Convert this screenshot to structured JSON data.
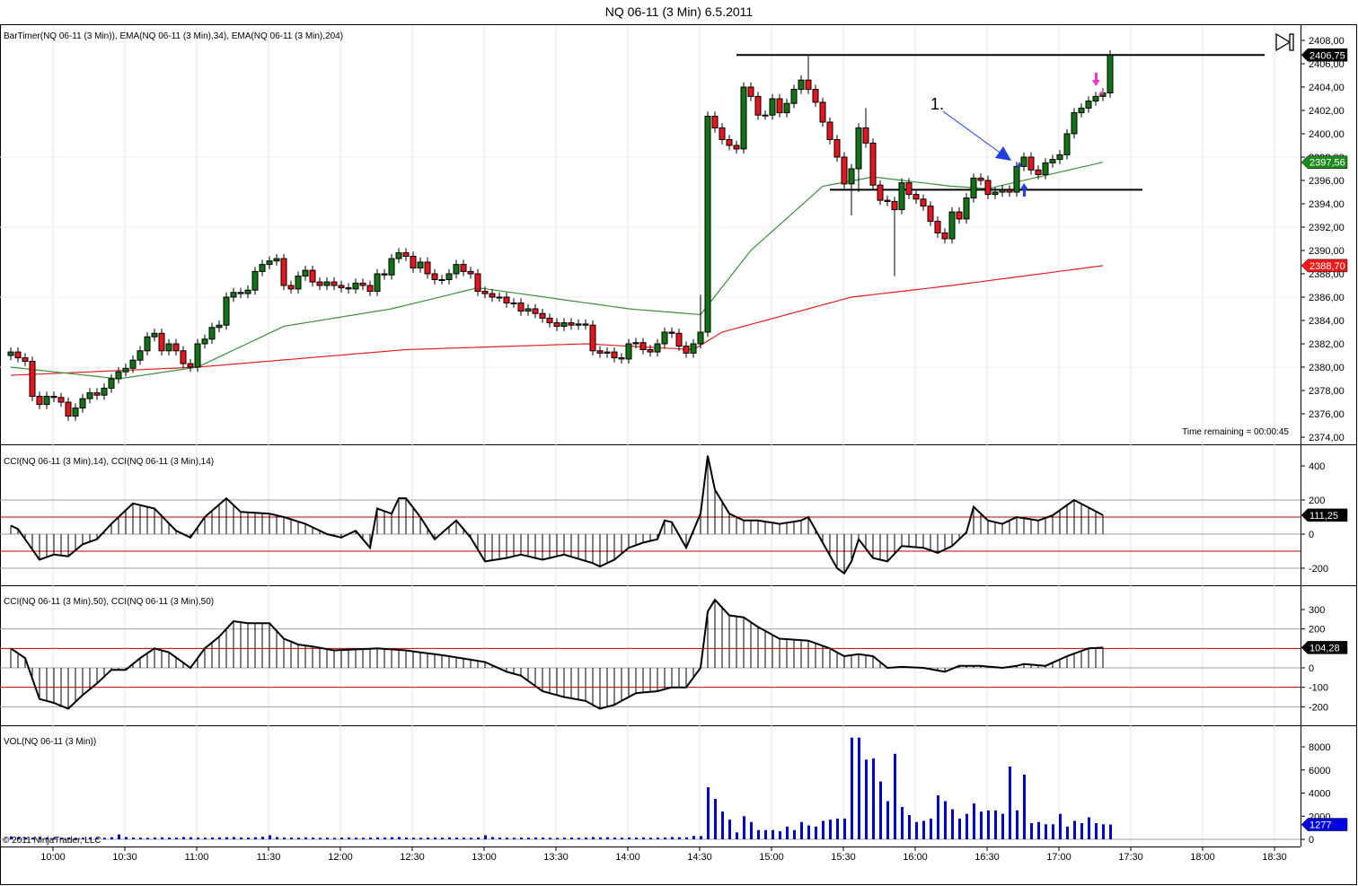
{
  "window": {
    "title": "NQ 06-11 (3 Min)  6.5.2011"
  },
  "colors": {
    "up": "#137313",
    "down": "#e8141c",
    "ema34": "#3d8f3d",
    "ema204": "#e02020",
    "volume": "#0000c8",
    "level_line": "#c00000",
    "annotation_blue": "#1f3fe0",
    "annotation_pink": "#ff33cc"
  },
  "panels": {
    "price": {
      "label": "BarTimer(NQ 06-11 (3 Min)), EMA(NQ 06-11 (3 Min),34), EMA(NQ 06-11 (3 Min),204)",
      "time_remaining": "Time remaining = 00:00:45"
    },
    "cci14": {
      "label": "CCI(NQ 06-11 (3 Min),14), CCI(NQ 06-11 (3 Min),14)"
    },
    "cci50": {
      "label": "CCI(NQ 06-11 (3 Min),50), CCI(NQ 06-11 (3 Min),50)"
    },
    "volume": {
      "label": "VOL(NQ 06-11 (3 Min))"
    },
    "copyright": "© 2011 NinjaTrader, LLC"
  },
  "chart_data": {
    "type": "candlestick",
    "title": "NQ 06-11 (3 Min)  6.5.2011",
    "bar_interval_minutes": 3,
    "first_bar_time": "9:42",
    "x_ticks": [
      "10:00",
      "10:30",
      "11:00",
      "11:30",
      "12:00",
      "12:30",
      "13:00",
      "13:30",
      "14:00",
      "14:30",
      "15:00",
      "15:30",
      "16:00",
      "16:30",
      "17:00",
      "17:30",
      "18:00",
      "18:30"
    ],
    "price_ticks": [
      "2408,00",
      "2406,00",
      "2404,00",
      "2402,00",
      "2400,00",
      "2398,00",
      "2396,00",
      "2394,00",
      "2392,00",
      "2390,00",
      "2388,00",
      "2386,00",
      "2384,00",
      "2382,00",
      "2380,00",
      "2378,00",
      "2376,00",
      "2374,00"
    ],
    "price_range": [
      2373.2,
      2409.3
    ],
    "closes": [
      2381.3,
      2380.8,
      2380.5,
      2377.5,
      2376.8,
      2377.5,
      2377.4,
      2377.0,
      2375.8,
      2376.5,
      2377.3,
      2377.8,
      2377.6,
      2378.2,
      2379.0,
      2379.6,
      2379.9,
      2380.6,
      2381.4,
      2382.6,
      2382.9,
      2381.4,
      2382.0,
      2381.4,
      2380.3,
      2380.0,
      2382.0,
      2382.4,
      2383.4,
      2383.6,
      2386.0,
      2386.4,
      2386.3,
      2386.6,
      2388.2,
      2388.8,
      2389.1,
      2389.3,
      2387.0,
      2386.7,
      2387.8,
      2388.3,
      2387.3,
      2387.0,
      2387.3,
      2387.0,
      2386.8,
      2386.7,
      2387.2,
      2387.0,
      2386.5,
      2388.0,
      2387.9,
      2389.3,
      2389.8,
      2389.5,
      2388.5,
      2389.0,
      2388.0,
      2387.5,
      2387.5,
      2388.0,
      2388.8,
      2388.2,
      2388.0,
      2386.5,
      2386.3,
      2386.0,
      2386.0,
      2385.5,
      2385.5,
      2384.8,
      2385.0,
      2384.6,
      2384.2,
      2383.8,
      2383.5,
      2383.8,
      2383.6,
      2383.7,
      2383.6,
      2381.4,
      2381.2,
      2381.3,
      2380.8,
      2380.7,
      2382.0,
      2382.1,
      2381.5,
      2381.3,
      2382.0,
      2383.0,
      2382.9,
      2381.8,
      2381.2,
      2382.0,
      2383.0,
      2401.5,
      2400.5,
      2399.5,
      2399.0,
      2398.7,
      2404.0,
      2403.2,
      2401.6,
      2401.6,
      2403.0,
      2401.8,
      2402.6,
      2403.8,
      2404.6,
      2403.8,
      2402.7,
      2401.0,
      2399.5,
      2398.0,
      2395.7,
      2397.0,
      2400.5,
      2399.2,
      2395.6,
      2394.3,
      2394.2,
      2393.5,
      2395.8,
      2394.8,
      2394.4,
      2393.8,
      2392.5,
      2391.5,
      2391.0,
      2393.3,
      2392.7,
      2394.5,
      2396.2,
      2396.0,
      2394.8,
      2395.0,
      2395.2,
      2395.0,
      2397.2,
      2398.0,
      2396.9,
      2396.5,
      2397.5,
      2397.8,
      2398.2,
      2400.0,
      2401.8,
      2402.2,
      2402.8,
      2403.2,
      2403.5,
      2406.75
    ],
    "first_open": 2381.0,
    "high_overrides": {
      "111": 2406.75,
      "119": 2402.2,
      "96": 2386.2
    },
    "low_overrides": {
      "117": 2393.0,
      "123": 2387.8,
      "118": 2395.0
    },
    "ema34_points": [
      [
        0,
        2380.0
      ],
      [
        15,
        2379.0
      ],
      [
        26,
        2380.0
      ],
      [
        38,
        2383.5
      ],
      [
        53,
        2385.0
      ],
      [
        65,
        2386.8
      ],
      [
        86,
        2385.0
      ],
      [
        96,
        2384.5
      ],
      [
        103,
        2390.0
      ],
      [
        113,
        2395.5
      ],
      [
        120,
        2396.3
      ],
      [
        131,
        2395.5
      ],
      [
        136,
        2395.3
      ],
      [
        152,
        2397.56
      ]
    ],
    "ema204_points": [
      [
        0,
        2379.3
      ],
      [
        26,
        2380.0
      ],
      [
        55,
        2381.5
      ],
      [
        80,
        2382.0
      ],
      [
        95,
        2381.5
      ],
      [
        99,
        2383.0
      ],
      [
        117,
        2386.0
      ],
      [
        131,
        2387.0
      ],
      [
        152,
        2388.7
      ]
    ],
    "last_values": {
      "price": "2406,75",
      "ema34": "2397,56",
      "ema204": "2388,70",
      "cci14": "111,25",
      "cci50": "104,28",
      "volume": "1277"
    },
    "drawn_levels": [
      {
        "price": 2406.75,
        "from_bar": 101,
        "to_bar": 175
      },
      {
        "price": 2395.2,
        "from_bar": 114,
        "to_bar": 158
      }
    ],
    "annotations": {
      "label": "1."
    },
    "cci14": {
      "ticks": [
        "400",
        "200",
        "0",
        "-200"
      ],
      "points": [
        [
          0,
          50
        ],
        [
          1,
          30
        ],
        [
          3,
          -90
        ],
        [
          4,
          -150
        ],
        [
          6,
          -120
        ],
        [
          8,
          -130
        ],
        [
          10,
          -60
        ],
        [
          12,
          -30
        ],
        [
          14,
          60
        ],
        [
          17,
          180
        ],
        [
          20,
          150
        ],
        [
          23,
          20
        ],
        [
          25,
          -20
        ],
        [
          27,
          100
        ],
        [
          30,
          210
        ],
        [
          32,
          130
        ],
        [
          36,
          120
        ],
        [
          38,
          100
        ],
        [
          41,
          60
        ],
        [
          44,
          0
        ],
        [
          46,
          -20
        ],
        [
          48,
          20
        ],
        [
          50,
          -80
        ],
        [
          51,
          150
        ],
        [
          53,
          120
        ],
        [
          54,
          210
        ],
        [
          55,
          210
        ],
        [
          57,
          100
        ],
        [
          59,
          -30
        ],
        [
          62,
          80
        ],
        [
          64,
          -20
        ],
        [
          66,
          -160
        ],
        [
          69,
          -140
        ],
        [
          71,
          -120
        ],
        [
          74,
          -150
        ],
        [
          77,
          -120
        ],
        [
          81,
          -170
        ],
        [
          82,
          -190
        ],
        [
          84,
          -150
        ],
        [
          86,
          -80
        ],
        [
          88,
          -50
        ],
        [
          90,
          -30
        ],
        [
          91,
          80
        ],
        [
          92,
          70
        ],
        [
          94,
          -80
        ],
        [
          96,
          120
        ],
        [
          97,
          460
        ],
        [
          98,
          260
        ],
        [
          100,
          120
        ],
        [
          102,
          80
        ],
        [
          104,
          80
        ],
        [
          107,
          60
        ],
        [
          110,
          80
        ],
        [
          111,
          100
        ],
        [
          113,
          -50
        ],
        [
          115,
          -200
        ],
        [
          116,
          -230
        ],
        [
          117,
          -160
        ],
        [
          118,
          -30
        ],
        [
          120,
          -140
        ],
        [
          122,
          -160
        ],
        [
          124,
          -70
        ],
        [
          127,
          -80
        ],
        [
          129,
          -110
        ],
        [
          131,
          -70
        ],
        [
          133,
          10
        ],
        [
          134,
          160
        ],
        [
          136,
          80
        ],
        [
          138,
          60
        ],
        [
          140,
          100
        ],
        [
          143,
          80
        ],
        [
          145,
          110
        ],
        [
          148,
          200
        ],
        [
          152,
          111.25
        ]
      ]
    },
    "cci50": {
      "ticks": [
        "300",
        "200",
        "0",
        "-100",
        "-200"
      ],
      "points": [
        [
          0,
          100
        ],
        [
          2,
          50
        ],
        [
          4,
          -160
        ],
        [
          6,
          -180
        ],
        [
          8,
          -210
        ],
        [
          10,
          -140
        ],
        [
          12,
          -80
        ],
        [
          14,
          -10
        ],
        [
          16,
          -10
        ],
        [
          18,
          50
        ],
        [
          20,
          100
        ],
        [
          22,
          80
        ],
        [
          25,
          0
        ],
        [
          27,
          100
        ],
        [
          29,
          160
        ],
        [
          31,
          240
        ],
        [
          33,
          230
        ],
        [
          36,
          230
        ],
        [
          38,
          150
        ],
        [
          40,
          120
        ],
        [
          42,
          110
        ],
        [
          45,
          90
        ],
        [
          51,
          100
        ],
        [
          55,
          90
        ],
        [
          61,
          60
        ],
        [
          66,
          30
        ],
        [
          69,
          -20
        ],
        [
          71,
          -40
        ],
        [
          74,
          -120
        ],
        [
          77,
          -150
        ],
        [
          80,
          -170
        ],
        [
          82,
          -210
        ],
        [
          84,
          -190
        ],
        [
          87,
          -130
        ],
        [
          90,
          -120
        ],
        [
          92,
          -100
        ],
        [
          94,
          -100
        ],
        [
          96,
          0
        ],
        [
          97,
          290
        ],
        [
          98,
          350
        ],
        [
          100,
          270
        ],
        [
          102,
          260
        ],
        [
          104,
          210
        ],
        [
          107,
          150
        ],
        [
          111,
          140
        ],
        [
          114,
          100
        ],
        [
          116,
          60
        ],
        [
          118,
          70
        ],
        [
          120,
          60
        ],
        [
          122,
          0
        ],
        [
          124,
          5
        ],
        [
          127,
          0
        ],
        [
          130,
          -20
        ],
        [
          132,
          10
        ],
        [
          135,
          10
        ],
        [
          138,
          0
        ],
        [
          140,
          10
        ],
        [
          141,
          20
        ],
        [
          144,
          10
        ],
        [
          147,
          60
        ],
        [
          150,
          100
        ],
        [
          152,
          104.28
        ]
      ]
    },
    "volume": {
      "ticks": [
        "8000",
        "6000",
        "4000",
        "2000",
        "0"
      ],
      "values": [
        250,
        180,
        160,
        150,
        200,
        170,
        140,
        150,
        160,
        130,
        140,
        150,
        120,
        130,
        180,
        420,
        200,
        150,
        140,
        130,
        160,
        170,
        150,
        140,
        200,
        180,
        150,
        140,
        160,
        170,
        180,
        200,
        160,
        150,
        180,
        220,
        350,
        200,
        160,
        150,
        140,
        170,
        150,
        130,
        140,
        120,
        150,
        160,
        140,
        130,
        150,
        170,
        160,
        180,
        200,
        150,
        140,
        130,
        150,
        160,
        140,
        170,
        150,
        140,
        130,
        160,
        350,
        200,
        150,
        140,
        130,
        150,
        140,
        160,
        150,
        130,
        120,
        140,
        150,
        130,
        160,
        200,
        170,
        180,
        150,
        140,
        160,
        150,
        170,
        140,
        150,
        160,
        200,
        180,
        170,
        300,
        280,
        4500,
        3500,
        2400,
        1700,
        600,
        2000,
        1500,
        800,
        800,
        800,
        700,
        1100,
        800,
        1500,
        1200,
        1100,
        1600,
        1700,
        1800,
        1800,
        8800,
        8800,
        6900,
        7000,
        5000,
        3300,
        7400,
        2800,
        2100,
        1500,
        1600,
        1800,
        3800,
        3300,
        2600,
        1800,
        2200,
        3100,
        2400,
        2500,
        2500,
        2200,
        6300,
        2500,
        5600,
        1400,
        1500,
        1300,
        1300,
        2200,
        1100,
        1600,
        1400,
        1900,
        1400,
        1300,
        1277
      ]
    }
  }
}
